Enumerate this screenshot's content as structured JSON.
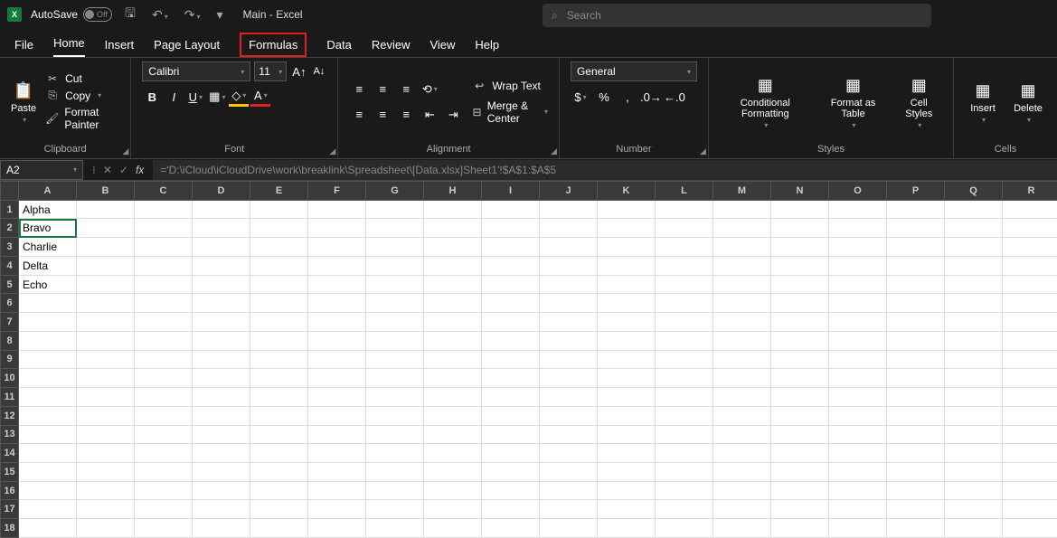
{
  "titlebar": {
    "autosave_label": "AutoSave",
    "autosave_state": "Off",
    "title": "Main - Excel",
    "search_placeholder": "Search"
  },
  "tabs": [
    "File",
    "Home",
    "Insert",
    "Page Layout",
    "Formulas",
    "Data",
    "Review",
    "View",
    "Help"
  ],
  "active_tab": "Home",
  "highlighted_tab": "Formulas",
  "ribbon": {
    "clipboard": {
      "paste": "Paste",
      "cut": "Cut",
      "copy": "Copy",
      "format_painter": "Format Painter",
      "label": "Clipboard"
    },
    "font": {
      "name": "Calibri",
      "size": "11",
      "label": "Font"
    },
    "alignment": {
      "wrap": "Wrap Text",
      "merge": "Merge & Center",
      "label": "Alignment"
    },
    "number": {
      "format": "General",
      "label": "Number"
    },
    "styles": {
      "conditional": "Conditional Formatting",
      "table": "Format as Table",
      "cellstyles": "Cell Styles",
      "label": "Styles"
    },
    "cells": {
      "insert": "Insert",
      "delete": "Delete",
      "label": "Cells"
    }
  },
  "formula_bar": {
    "cell_ref": "A2",
    "formula": "='D:\\iCloud\\iCloudDrive\\work\\breaklink\\Spreadsheet\\[Data.xlsx]Sheet1'!$A$1:$A$5"
  },
  "grid": {
    "columns": [
      "A",
      "B",
      "C",
      "D",
      "E",
      "F",
      "G",
      "H",
      "I",
      "J",
      "K",
      "L",
      "M",
      "N",
      "O",
      "P",
      "Q",
      "R"
    ],
    "rows": 18,
    "selected": "A2",
    "data": {
      "A1": "Alpha",
      "A2": "Bravo",
      "A3": "Charlie",
      "A4": "Delta",
      "A5": "Echo"
    }
  }
}
